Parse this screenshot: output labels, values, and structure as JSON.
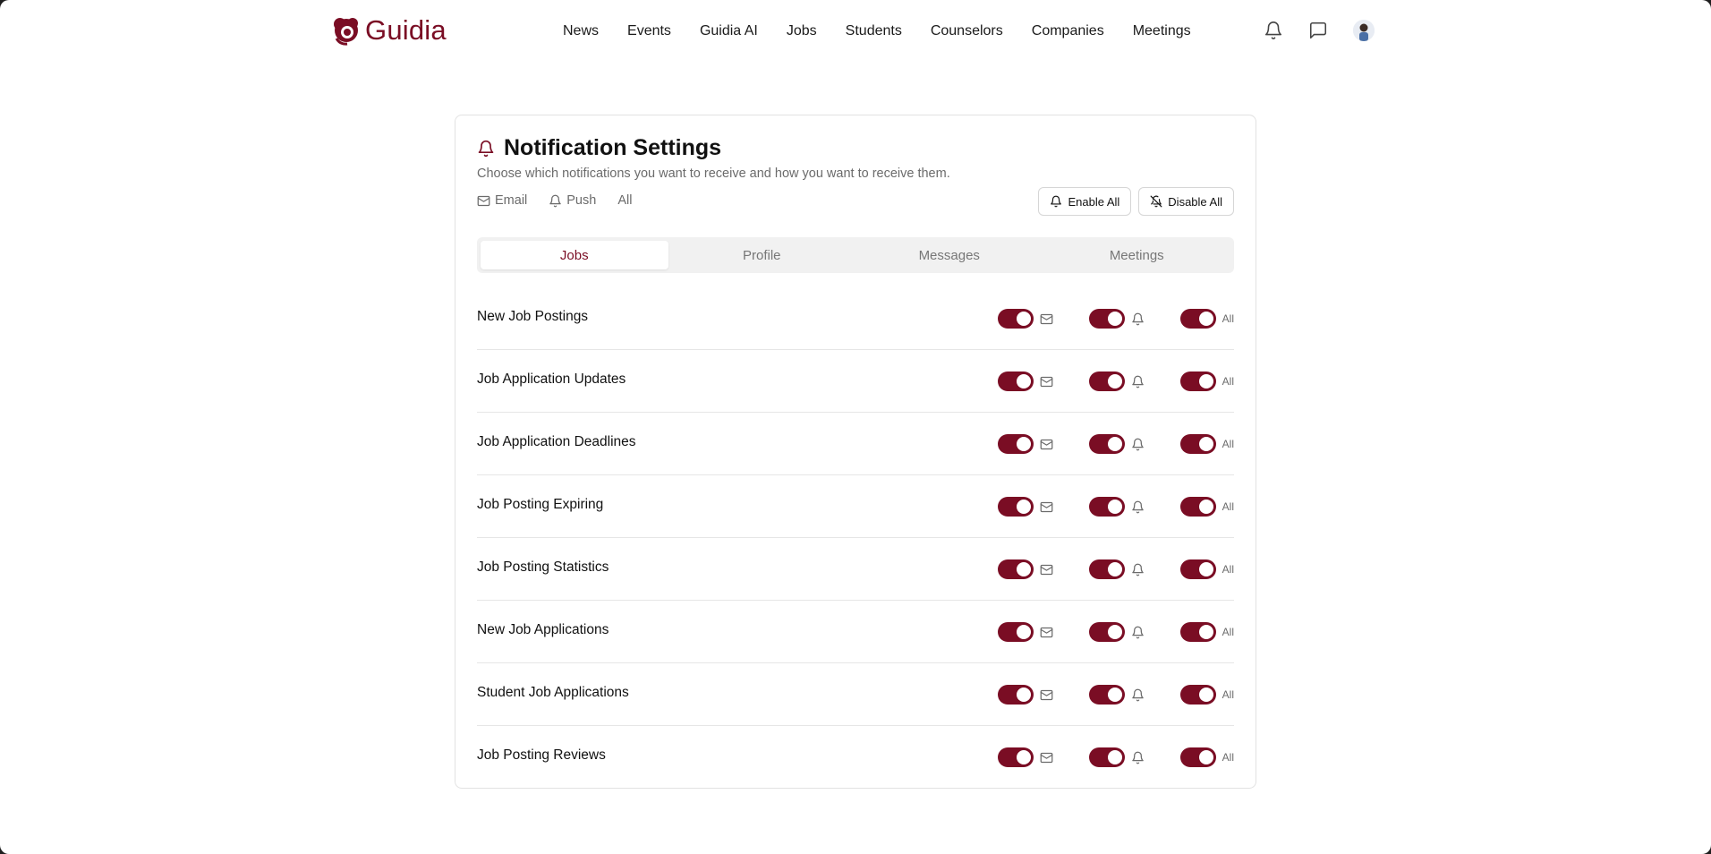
{
  "header": {
    "brand": "Guidia",
    "nav": [
      "News",
      "Events",
      "Guidia AI",
      "Jobs",
      "Students",
      "Counselors",
      "Companies",
      "Meetings"
    ],
    "icons": [
      "bell-icon",
      "chat-icon",
      "avatar"
    ]
  },
  "settings": {
    "title": "Notification Settings",
    "subtitle": "Choose which notifications you want to receive and how you want to receive them.",
    "legend": {
      "email": "Email",
      "push": "Push",
      "all": "All"
    },
    "enable_all": "Enable All",
    "disable_all": "Disable All",
    "tabs": [
      {
        "label": "Jobs",
        "active": true
      },
      {
        "label": "Profile",
        "active": false
      },
      {
        "label": "Messages",
        "active": false
      },
      {
        "label": "Meetings",
        "active": false
      }
    ],
    "all_label": "All",
    "rows": [
      {
        "label": "New Job Postings",
        "email": true,
        "push": true,
        "all": true
      },
      {
        "label": "Job Application Updates",
        "email": true,
        "push": true,
        "all": true
      },
      {
        "label": "Job Application Deadlines",
        "email": true,
        "push": true,
        "all": true
      },
      {
        "label": "Job Posting Expiring",
        "email": true,
        "push": true,
        "all": true
      },
      {
        "label": "Job Posting Statistics",
        "email": true,
        "push": true,
        "all": true
      },
      {
        "label": "New Job Applications",
        "email": true,
        "push": true,
        "all": true
      },
      {
        "label": "Student Job Applications",
        "email": true,
        "push": true,
        "all": true
      },
      {
        "label": "Job Posting Reviews",
        "email": true,
        "push": true,
        "all": true
      }
    ]
  },
  "colors": {
    "accent": "#7a0d24",
    "muted": "#6b6b6b",
    "border": "#e2e2e2"
  }
}
